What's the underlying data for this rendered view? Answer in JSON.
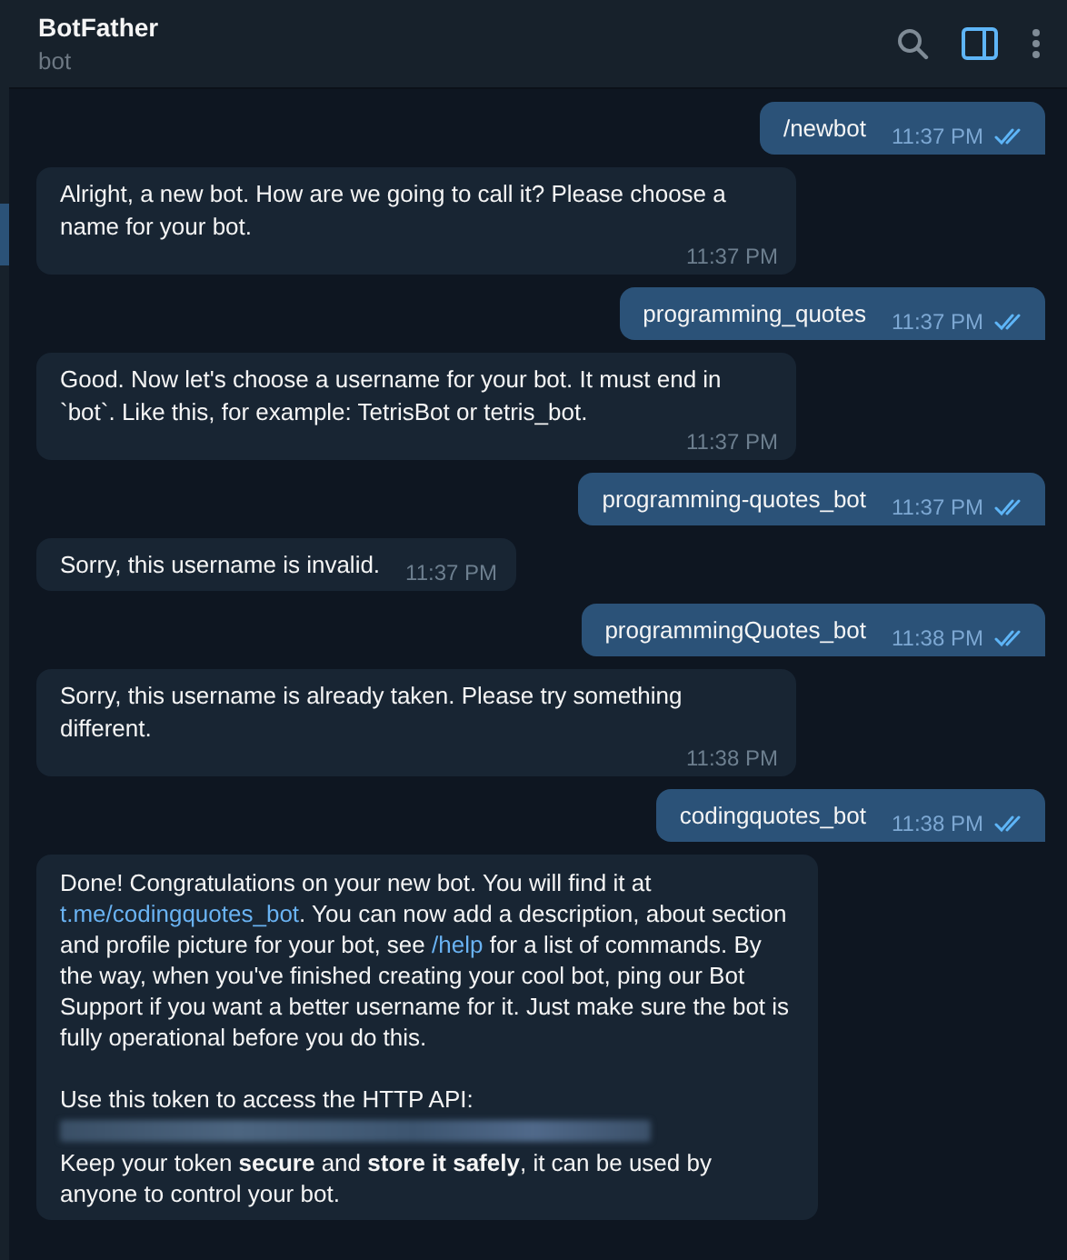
{
  "header": {
    "title": "BotFather",
    "subtitle": "bot",
    "actions": [
      {
        "kind": "search",
        "active": false
      },
      {
        "kind": "panel",
        "active": true
      },
      {
        "kind": "more",
        "active": false
      }
    ]
  },
  "messages": [
    {
      "kind": "out",
      "text": "/newbot",
      "time": "11:37 PM",
      "read": true
    },
    {
      "kind": "in",
      "text": "Alright, a new bot. How are we going to call it? Please choose a name for your bot.",
      "time": "11:37 PM"
    },
    {
      "kind": "out",
      "text": "programming_quotes",
      "time": "11:37 PM",
      "read": true
    },
    {
      "kind": "in",
      "text": "Good. Now let's choose a username for your bot. It must end in `bot`. Like this, for example: TetrisBot or tetris_bot.",
      "time": "11:37 PM"
    },
    {
      "kind": "out",
      "text": "programming-quotes_bot",
      "time": "11:37 PM",
      "read": true
    },
    {
      "kind": "in",
      "text": "Sorry, this username is invalid.",
      "time": "11:37 PM"
    },
    {
      "kind": "out",
      "text": "programmingQuotes_bot",
      "time": "11:38 PM",
      "read": true
    },
    {
      "kind": "in",
      "text": "Sorry, this username is already taken. Please try something different.",
      "time": "11:38 PM"
    },
    {
      "kind": "out",
      "text": "codingquotes_bot",
      "time": "11:38 PM",
      "read": true
    },
    {
      "kind": "rich",
      "paragraphs": [
        [
          {
            "kind": "text",
            "text": "Done! Congratulations on your new bot. You will find it at "
          },
          {
            "kind": "link",
            "text": "t.me/codingquotes_bot"
          },
          {
            "kind": "text",
            "text": ". You can now add a description, about section and profile picture for your bot, see "
          },
          {
            "kind": "link",
            "text": "/help"
          },
          {
            "kind": "text",
            "text": " for a list of commands. By the way, when you've finished creating your cool bot, ping our Bot Support if you want a better username for it. Just make sure the bot is fully operational before you do this."
          }
        ],
        [
          {
            "kind": "text",
            "text": "Use this token to access the HTTP API:"
          }
        ],
        [
          {
            "kind": "redacted"
          }
        ],
        [
          {
            "kind": "text",
            "text": "Keep your token **secure** and **store it safely**, it can be used by anyone to control your bot."
          }
        ]
      ]
    }
  ]
}
